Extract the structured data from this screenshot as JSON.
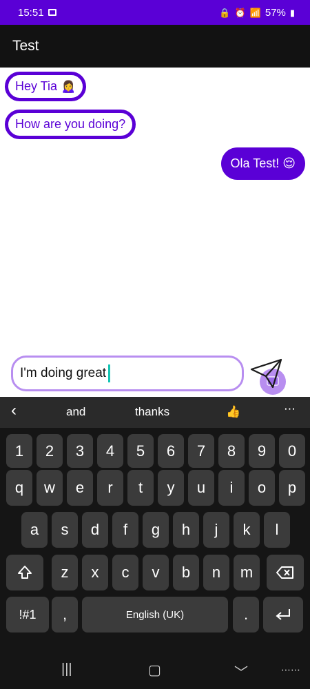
{
  "status_bar": {
    "time": "15:51",
    "battery": "57%"
  },
  "app_bar": {
    "title": "Test"
  },
  "messages": [
    {
      "text": "Hey Tia 🙍‍♀️",
      "direction": "incoming"
    },
    {
      "text": "How are you doing?",
      "direction": "incoming"
    },
    {
      "text": "Ola Test! 😌",
      "direction": "outgoing"
    }
  ],
  "composer": {
    "value": "I'm doing great"
  },
  "keyboard": {
    "suggestions": [
      "and",
      "thanks",
      "👍"
    ],
    "row_numbers": [
      "1",
      "2",
      "3",
      "4",
      "5",
      "6",
      "7",
      "8",
      "9",
      "0"
    ],
    "row1": [
      "q",
      "w",
      "e",
      "r",
      "t",
      "y",
      "u",
      "i",
      "o",
      "p"
    ],
    "row2": [
      "a",
      "s",
      "d",
      "f",
      "g",
      "h",
      "j",
      "k",
      "l"
    ],
    "row3": [
      "z",
      "x",
      "c",
      "v",
      "b",
      "n",
      "m"
    ],
    "symbols_label": "!#1",
    "comma": ",",
    "space_label": "English (UK)",
    "period": "."
  },
  "colors": {
    "accent": "#5a00d6",
    "accent_light": "#b88ef0",
    "caret": "#15c5b4"
  }
}
